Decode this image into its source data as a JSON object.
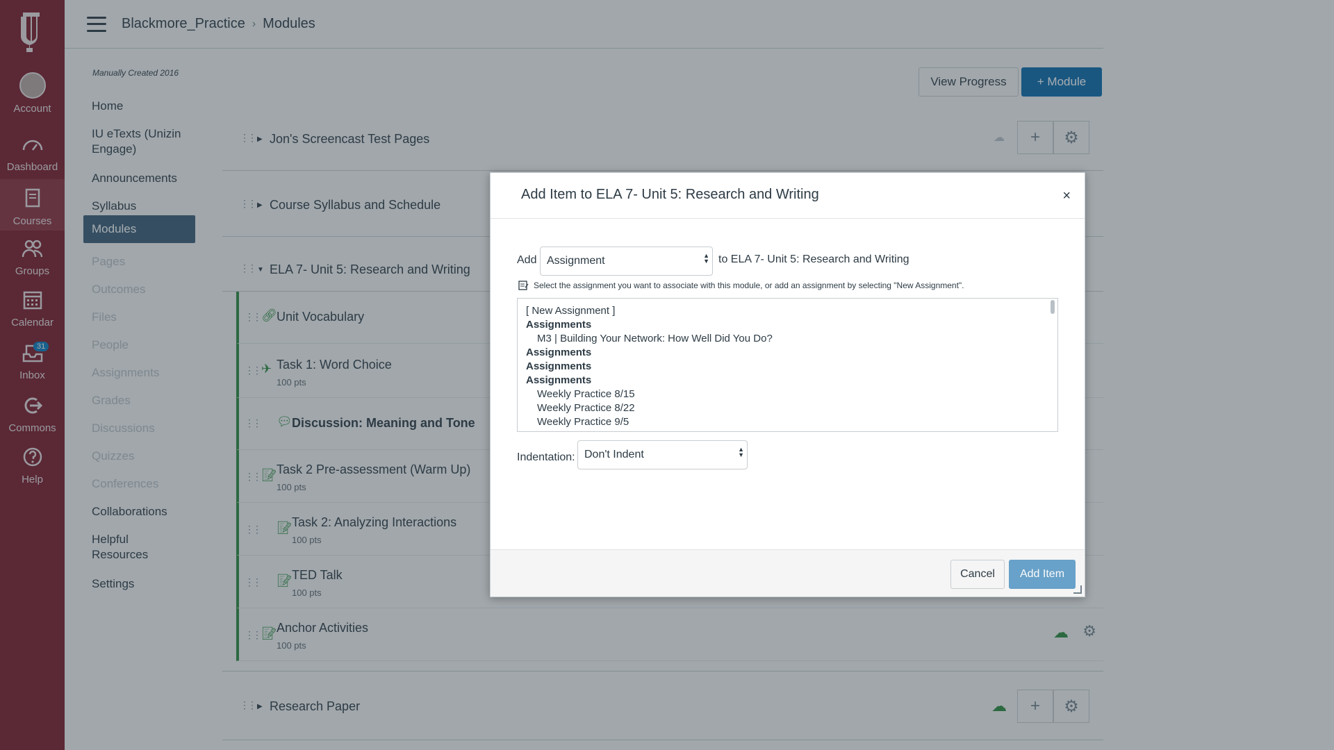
{
  "global_nav": {
    "items": [
      {
        "label": "Account",
        "icon": "avatar"
      },
      {
        "label": "Dashboard",
        "icon": "dashboard-icon"
      },
      {
        "label": "Courses",
        "icon": "courses-icon"
      },
      {
        "label": "Groups",
        "icon": "groups-icon"
      },
      {
        "label": "Calendar",
        "icon": "calendar-icon"
      },
      {
        "label": "Inbox",
        "icon": "inbox-icon",
        "badge": "31"
      },
      {
        "label": "Commons",
        "icon": "commons-icon"
      },
      {
        "label": "Help",
        "icon": "help-icon"
      }
    ]
  },
  "header": {
    "course": "Blackmore_Practice",
    "separator": "›",
    "page": "Modules"
  },
  "course_nav": {
    "term": "Manually Created 2016",
    "items": [
      {
        "label": "Home"
      },
      {
        "label": "IU eTexts (Unizin Engage)"
      },
      {
        "label": "Announcements"
      },
      {
        "label": "Syllabus"
      },
      {
        "label": "Modules"
      },
      {
        "label": "Pages"
      },
      {
        "label": "Outcomes"
      },
      {
        "label": "Files"
      },
      {
        "label": "People"
      },
      {
        "label": "Assignments"
      },
      {
        "label": "Grades"
      },
      {
        "label": "Discussions"
      },
      {
        "label": "Quizzes"
      },
      {
        "label": "Conferences"
      },
      {
        "label": "Collaborations"
      },
      {
        "label": "Helpful Resources"
      },
      {
        "label": "Settings"
      }
    ]
  },
  "toolbar": {
    "view_progress": "View Progress",
    "add_module": "+ Module"
  },
  "modules": {
    "m1": "Jon's Screencast Test Pages",
    "m2": "Course Syllabus and Schedule",
    "m3": "ELA 7- Unit 5: Research and Writing",
    "m4": "Research Paper",
    "items": [
      {
        "title": "Unit Vocabulary",
        "pts": ""
      },
      {
        "title": "Task 1: Word Choice",
        "pts": "100 pts"
      },
      {
        "title": "Discussion: Meaning and Tone",
        "pts": ""
      },
      {
        "title": "Task 2 Pre-assessment (Warm Up)",
        "pts": "100 pts"
      },
      {
        "title": "Task 2: Analyzing Interactions",
        "pts": "100 pts"
      },
      {
        "title": "TED Talk",
        "pts": "100 pts"
      },
      {
        "title": "Anchor Activities",
        "pts": "100 pts"
      }
    ]
  },
  "dialog": {
    "title": "Add Item to ELA 7- Unit 5: Research and Writing",
    "close": "×",
    "add_label": "Add",
    "type_value": "Assignment",
    "to_label": "to ELA 7- Unit 5: Research and Writing",
    "hint": "Select the assignment you want to associate with this module, or add an assignment by selecting \"New Assignment\".",
    "options": [
      {
        "text": "[ New Assignment ]",
        "kind": "opt"
      },
      {
        "text": "Assignments",
        "kind": "group"
      },
      {
        "text": "M3 | Building Your Network: How Well Did You Do?",
        "kind": "child"
      },
      {
        "text": "Assignments",
        "kind": "group"
      },
      {
        "text": "Assignments",
        "kind": "group"
      },
      {
        "text": "Assignments",
        "kind": "group"
      },
      {
        "text": "Weekly Practice 8/15",
        "kind": "child"
      },
      {
        "text": "Weekly Practice 8/22",
        "kind": "child"
      },
      {
        "text": "Weekly Practice 9/5",
        "kind": "child"
      }
    ],
    "indent_label": "Indentation:",
    "indent_value": "Don't Indent",
    "cancel": "Cancel",
    "add_item": "Add Item"
  },
  "colors": {
    "global_nav_bg": "#7d1a2a",
    "primary": "#0b6bad",
    "published_green": "#2b8a3e",
    "active_nav": "#3b5c78"
  }
}
